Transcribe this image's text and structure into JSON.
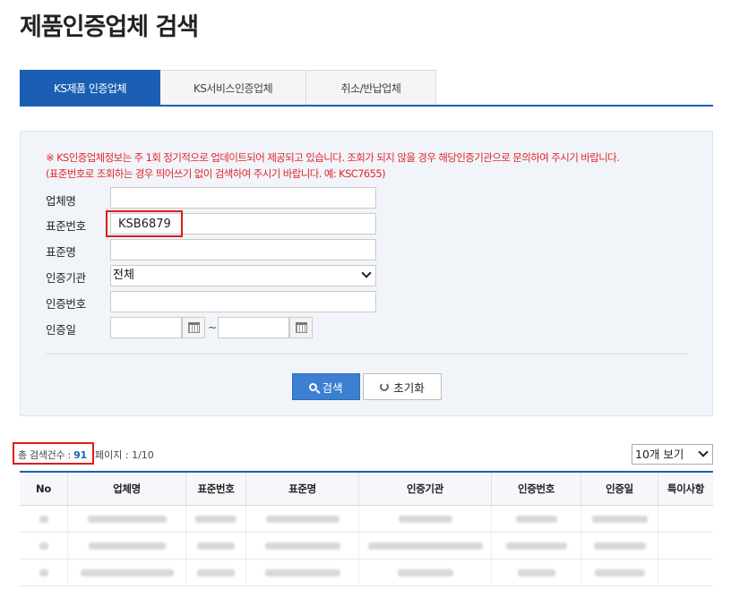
{
  "page": {
    "title": "제품인증업체 검색"
  },
  "tabs": [
    {
      "label": "KS제품 인증업체",
      "active": true
    },
    {
      "label": "KS서비스인증업체",
      "active": false
    },
    {
      "label": "취소/반납업체",
      "active": false
    }
  ],
  "notice": {
    "line1": "※ KS인증업체정보는 주 1회 정기적으로 업데이트되어 제공되고 있습니다. 조회가 되지 않을 경우 해당인증기관으로 문의하여 주시기 바랍니다.",
    "line2": "(표준번호로 조회하는 경우 띄어쓰기 없이 검색하여 주시기 바랍니다. 예: KSC7655)"
  },
  "form": {
    "company_label": "업체명",
    "company_value": "",
    "standard_no_label": "표준번호",
    "standard_no_value": "KSB6879",
    "standard_name_label": "표준명",
    "standard_name_value": "",
    "agency_label": "인증기관",
    "agency_value": "전체",
    "cert_no_label": "인증번호",
    "cert_no_value": "",
    "cert_date_label": "인증일",
    "date_separator": "~"
  },
  "buttons": {
    "search": "검색",
    "reset": "초기화"
  },
  "summary": {
    "total_label": "총 검색건수 :",
    "total_count": "91",
    "page_label": "페이지 :",
    "page_current": "1",
    "page_total": "/10"
  },
  "per_page": {
    "selected": "10개 보기"
  },
  "table": {
    "headers": [
      "No",
      "업체명",
      "표준번호",
      "표준명",
      "인증기관",
      "인증번호",
      "인증일",
      "특이사항"
    ]
  },
  "colors": {
    "primary": "#1a5fb4",
    "highlight": "#e01b1b",
    "notice": "#e0262b"
  },
  "icons": {
    "search": "search-icon",
    "reset": "refresh-icon",
    "calendar": "calendar-icon",
    "dropdown": "chevron-down-icon"
  }
}
